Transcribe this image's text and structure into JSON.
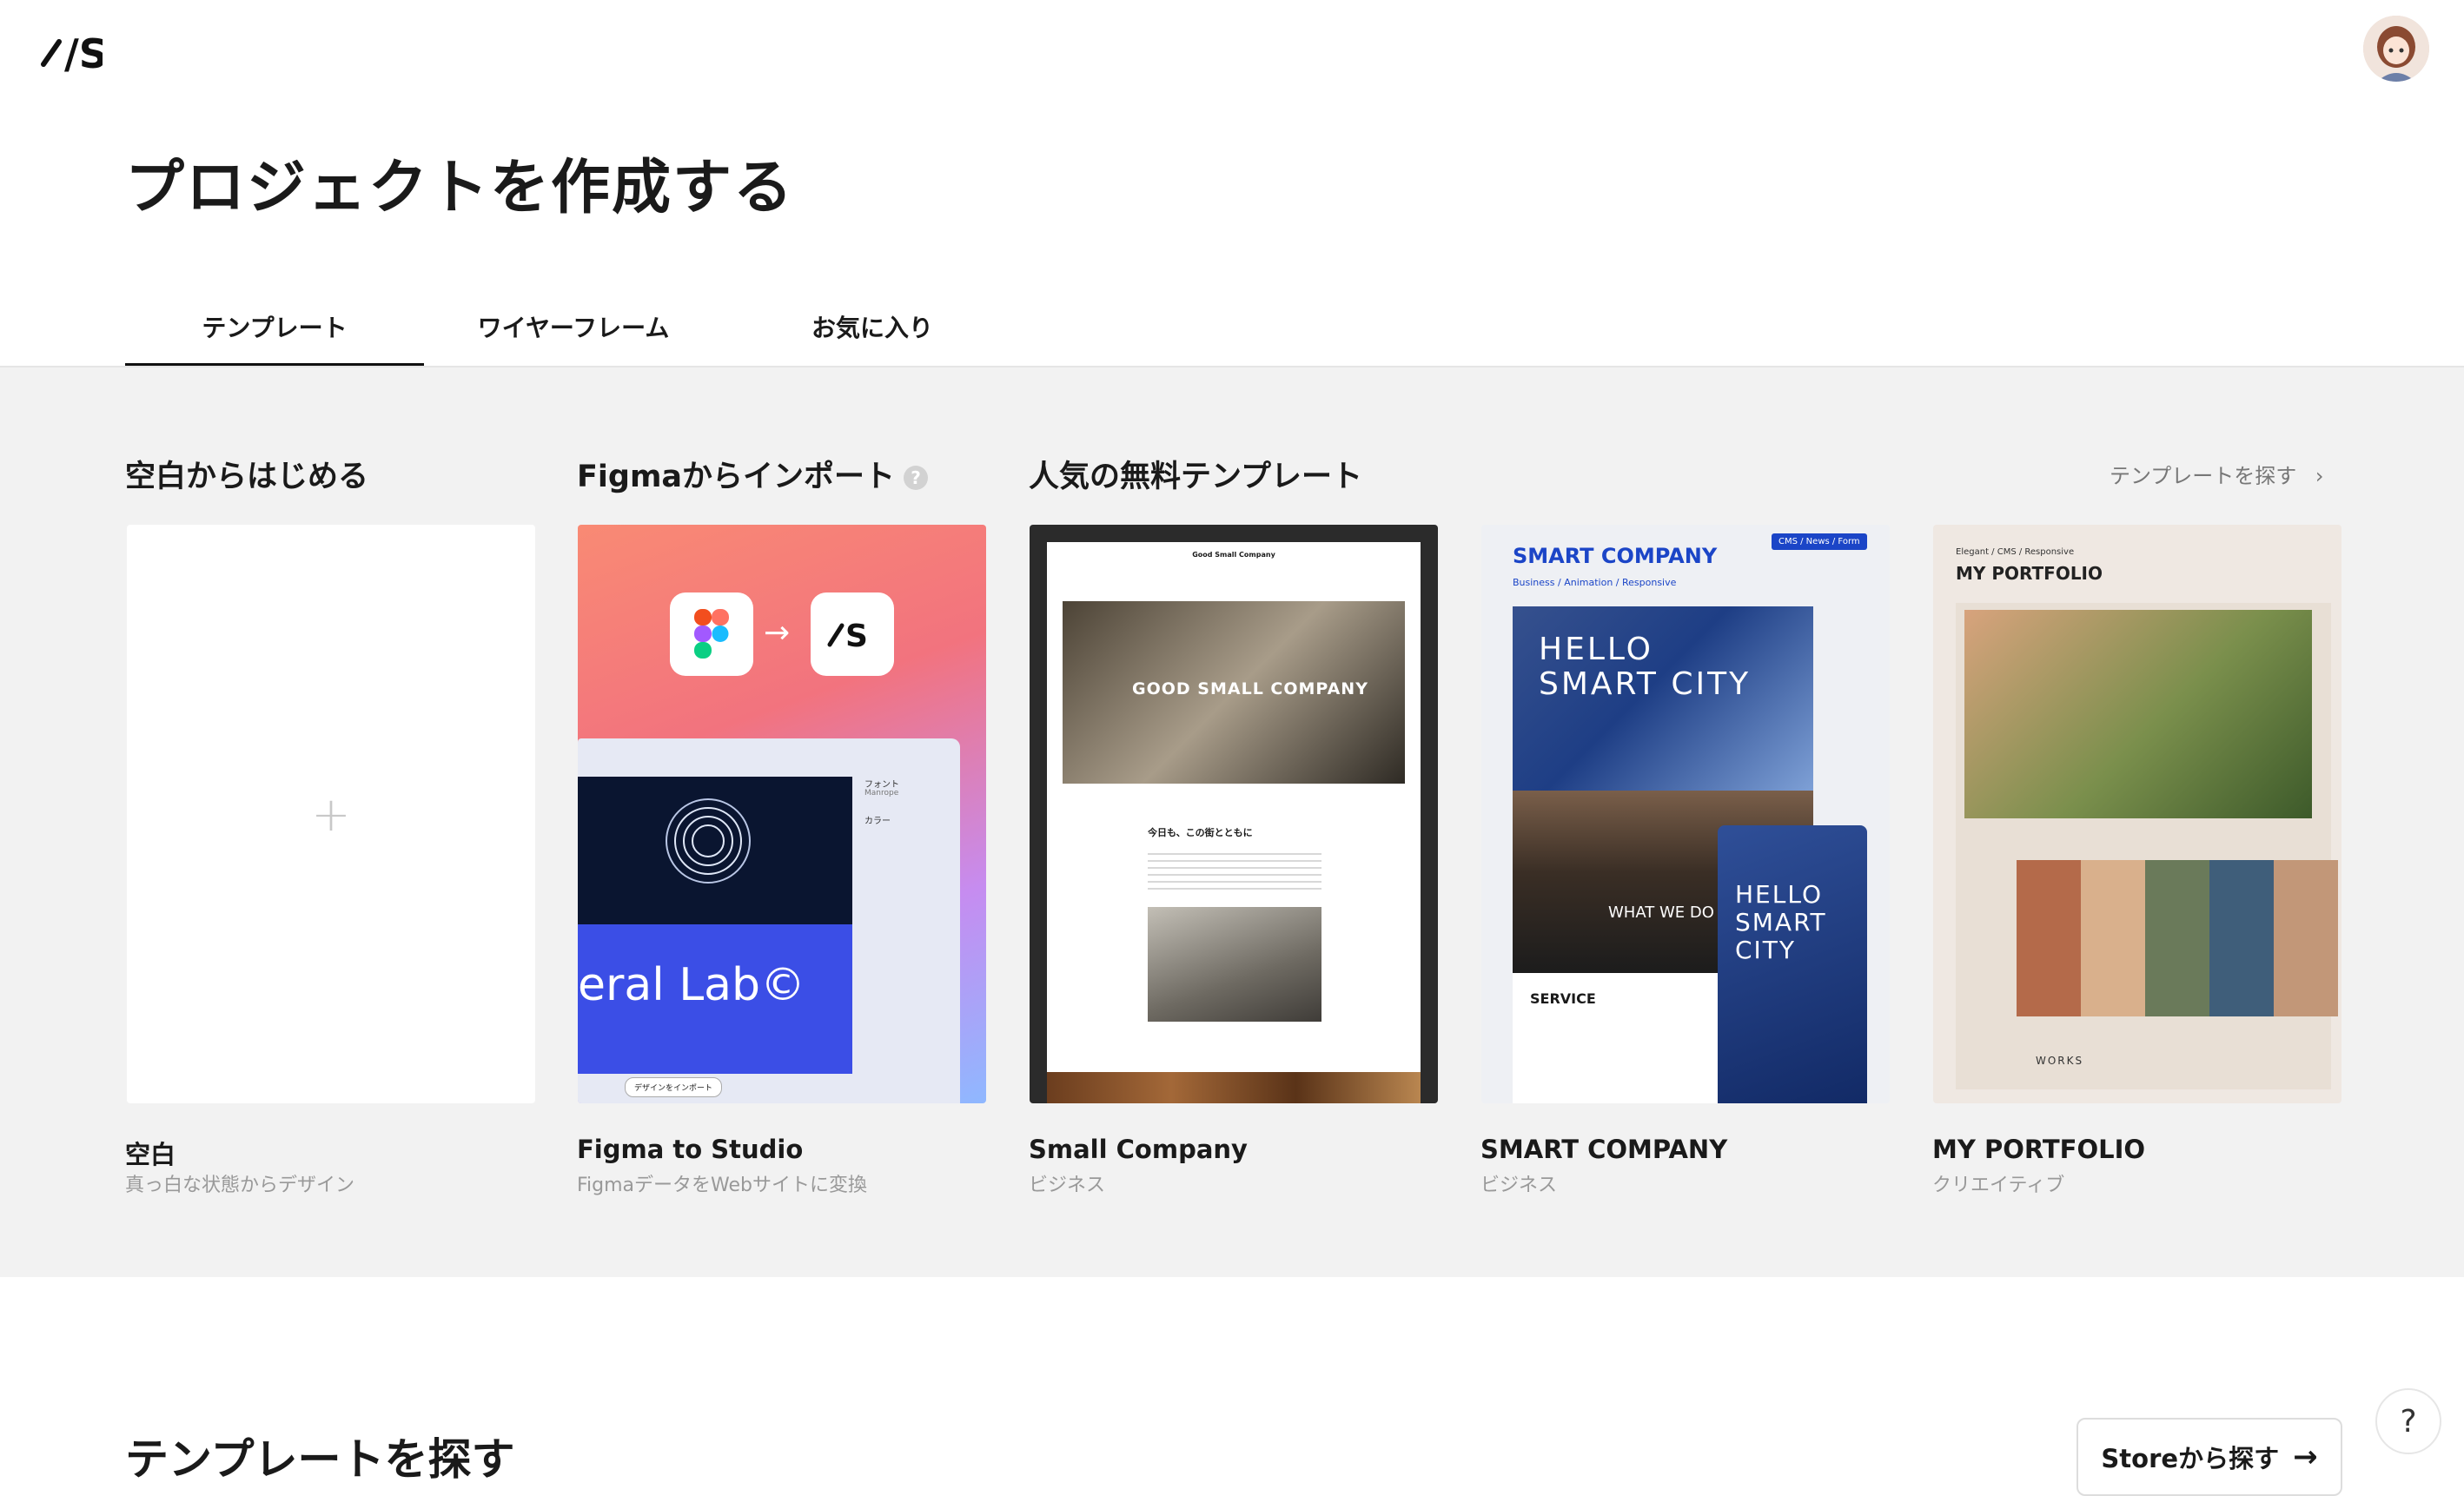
{
  "app": {
    "logo_text": "/S"
  },
  "page": {
    "title": "プロジェクトを作成する"
  },
  "tabs": [
    {
      "label": "テンプレート",
      "active": true
    },
    {
      "label": "ワイヤーフレーム",
      "active": false
    },
    {
      "label": "お気に入り",
      "active": false
    }
  ],
  "sections": {
    "blank": "空白からはじめる",
    "figma": "Figmaからインポート",
    "popular": "人気の無料テンプレート",
    "find_link": "テンプレートを探す"
  },
  "cards": [
    {
      "title": "空白",
      "subtitle": "真っ白な状態からデザイン"
    },
    {
      "title": "Figma to Studio",
      "subtitle": "FigmaデータをWebサイトに変換"
    },
    {
      "title": "Small Company",
      "subtitle": "ビジネス"
    },
    {
      "title": "SMART COMPANY",
      "subtitle": "ビジネス"
    },
    {
      "title": "MY PORTFOLIO",
      "subtitle": "クリエイティブ"
    }
  ],
  "previews": {
    "figma_fonts": "フォント",
    "figma_font_name": "Manrope",
    "figma_color": "カラー",
    "figma_big": "eral Lab©",
    "figma_import_btn": "デザインをインポート",
    "good_small_header": "Good Small Company",
    "good_small_hero": "GOOD SMALL COMPANY",
    "good_small_sub": "今日も、この街とともに",
    "smart_logo": "SMART COMPANY",
    "smart_tags": "Business / Animation / Responsive",
    "smart_badge": "CMS / News / Form",
    "smart_hero": "HELLO SMART CITY",
    "smart_hero_small": "HELLO SMART CITY",
    "smart_what": "WHAT WE DO",
    "smart_service": "SERVICE",
    "portfolio_tags": "Elegant / CMS / Responsive",
    "portfolio_logo": "MY PORTFOLIO",
    "portfolio_works": "WORKS"
  },
  "bottom": {
    "title": "テンプレートを探す",
    "store_button": "Storeから探す"
  },
  "help": {
    "label": "?"
  },
  "colors": {
    "accent_blue": "#1b45c7",
    "figma_gradient_top": "#f77b6c",
    "figma_gradient_bottom": "#b9a0ff"
  }
}
